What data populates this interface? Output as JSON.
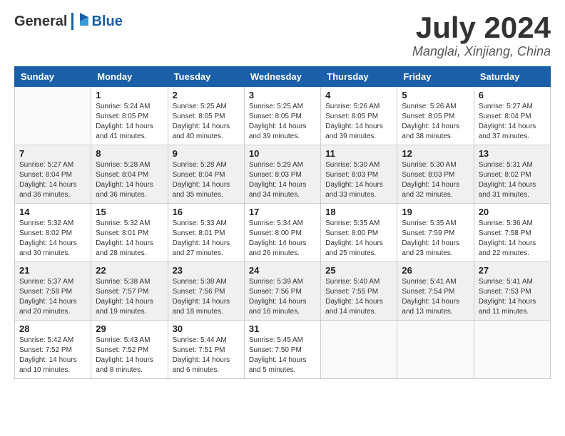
{
  "header": {
    "logo_general": "General",
    "logo_blue": "Blue",
    "month_title": "July 2024",
    "location": "Manglai, Xinjiang, China"
  },
  "weekdays": [
    "Sunday",
    "Monday",
    "Tuesday",
    "Wednesday",
    "Thursday",
    "Friday",
    "Saturday"
  ],
  "weeks": [
    [
      {
        "day": "",
        "info": ""
      },
      {
        "day": "1",
        "info": "Sunrise: 5:24 AM\nSunset: 8:05 PM\nDaylight: 14 hours\nand 41 minutes."
      },
      {
        "day": "2",
        "info": "Sunrise: 5:25 AM\nSunset: 8:05 PM\nDaylight: 14 hours\nand 40 minutes."
      },
      {
        "day": "3",
        "info": "Sunrise: 5:25 AM\nSunset: 8:05 PM\nDaylight: 14 hours\nand 39 minutes."
      },
      {
        "day": "4",
        "info": "Sunrise: 5:26 AM\nSunset: 8:05 PM\nDaylight: 14 hours\nand 39 minutes."
      },
      {
        "day": "5",
        "info": "Sunrise: 5:26 AM\nSunset: 8:05 PM\nDaylight: 14 hours\nand 38 minutes."
      },
      {
        "day": "6",
        "info": "Sunrise: 5:27 AM\nSunset: 8:04 PM\nDaylight: 14 hours\nand 37 minutes."
      }
    ],
    [
      {
        "day": "7",
        "info": "Sunrise: 5:27 AM\nSunset: 8:04 PM\nDaylight: 14 hours\nand 36 minutes."
      },
      {
        "day": "8",
        "info": "Sunrise: 5:28 AM\nSunset: 8:04 PM\nDaylight: 14 hours\nand 36 minutes."
      },
      {
        "day": "9",
        "info": "Sunrise: 5:28 AM\nSunset: 8:04 PM\nDaylight: 14 hours\nand 35 minutes."
      },
      {
        "day": "10",
        "info": "Sunrise: 5:29 AM\nSunset: 8:03 PM\nDaylight: 14 hours\nand 34 minutes."
      },
      {
        "day": "11",
        "info": "Sunrise: 5:30 AM\nSunset: 8:03 PM\nDaylight: 14 hours\nand 33 minutes."
      },
      {
        "day": "12",
        "info": "Sunrise: 5:30 AM\nSunset: 8:03 PM\nDaylight: 14 hours\nand 32 minutes."
      },
      {
        "day": "13",
        "info": "Sunrise: 5:31 AM\nSunset: 8:02 PM\nDaylight: 14 hours\nand 31 minutes."
      }
    ],
    [
      {
        "day": "14",
        "info": "Sunrise: 5:32 AM\nSunset: 8:02 PM\nDaylight: 14 hours\nand 30 minutes."
      },
      {
        "day": "15",
        "info": "Sunrise: 5:32 AM\nSunset: 8:01 PM\nDaylight: 14 hours\nand 28 minutes."
      },
      {
        "day": "16",
        "info": "Sunrise: 5:33 AM\nSunset: 8:01 PM\nDaylight: 14 hours\nand 27 minutes."
      },
      {
        "day": "17",
        "info": "Sunrise: 5:34 AM\nSunset: 8:00 PM\nDaylight: 14 hours\nand 26 minutes."
      },
      {
        "day": "18",
        "info": "Sunrise: 5:35 AM\nSunset: 8:00 PM\nDaylight: 14 hours\nand 25 minutes."
      },
      {
        "day": "19",
        "info": "Sunrise: 5:35 AM\nSunset: 7:59 PM\nDaylight: 14 hours\nand 23 minutes."
      },
      {
        "day": "20",
        "info": "Sunrise: 5:36 AM\nSunset: 7:58 PM\nDaylight: 14 hours\nand 22 minutes."
      }
    ],
    [
      {
        "day": "21",
        "info": "Sunrise: 5:37 AM\nSunset: 7:58 PM\nDaylight: 14 hours\nand 20 minutes."
      },
      {
        "day": "22",
        "info": "Sunrise: 5:38 AM\nSunset: 7:57 PM\nDaylight: 14 hours\nand 19 minutes."
      },
      {
        "day": "23",
        "info": "Sunrise: 5:38 AM\nSunset: 7:56 PM\nDaylight: 14 hours\nand 18 minutes."
      },
      {
        "day": "24",
        "info": "Sunrise: 5:39 AM\nSunset: 7:56 PM\nDaylight: 14 hours\nand 16 minutes."
      },
      {
        "day": "25",
        "info": "Sunrise: 5:40 AM\nSunset: 7:55 PM\nDaylight: 14 hours\nand 14 minutes."
      },
      {
        "day": "26",
        "info": "Sunrise: 5:41 AM\nSunset: 7:54 PM\nDaylight: 14 hours\nand 13 minutes."
      },
      {
        "day": "27",
        "info": "Sunrise: 5:41 AM\nSunset: 7:53 PM\nDaylight: 14 hours\nand 11 minutes."
      }
    ],
    [
      {
        "day": "28",
        "info": "Sunrise: 5:42 AM\nSunset: 7:52 PM\nDaylight: 14 hours\nand 10 minutes."
      },
      {
        "day": "29",
        "info": "Sunrise: 5:43 AM\nSunset: 7:52 PM\nDaylight: 14 hours\nand 8 minutes."
      },
      {
        "day": "30",
        "info": "Sunrise: 5:44 AM\nSunset: 7:51 PM\nDaylight: 14 hours\nand 6 minutes."
      },
      {
        "day": "31",
        "info": "Sunrise: 5:45 AM\nSunset: 7:50 PM\nDaylight: 14 hours\nand 5 minutes."
      },
      {
        "day": "",
        "info": ""
      },
      {
        "day": "",
        "info": ""
      },
      {
        "day": "",
        "info": ""
      }
    ]
  ]
}
